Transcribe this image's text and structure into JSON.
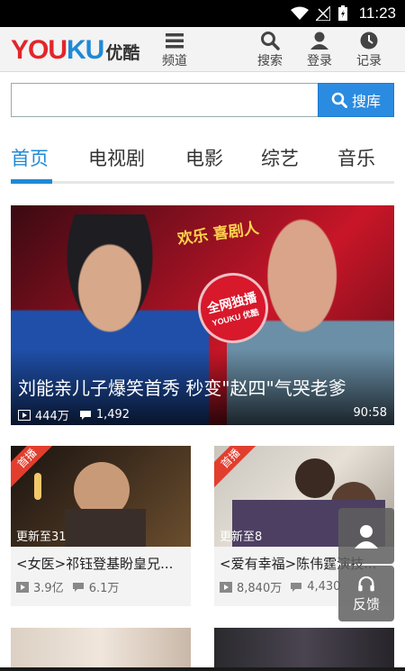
{
  "status_bar": {
    "time": "11:23"
  },
  "header": {
    "logo_en_a": "YOU",
    "logo_en_b": "KU",
    "logo_cn": "优酷",
    "channels_label": "频道",
    "search_label": "搜索",
    "login_label": "登录",
    "history_label": "记录"
  },
  "search": {
    "placeholder": "",
    "value": "",
    "button_label": "搜库"
  },
  "tabs": [
    {
      "label": "首页",
      "active": true
    },
    {
      "label": "电视剧"
    },
    {
      "label": "电影"
    },
    {
      "label": "综艺"
    },
    {
      "label": "音乐"
    }
  ],
  "hero": {
    "show_logo": "欢乐 喜剧人",
    "stamp_line1": "全网独播",
    "stamp_line2": "YOUKU 优酷",
    "title": "刘能亲儿子爆笑首秀 秒变\"赵四\"气哭老爹",
    "plays": "444万",
    "comments": "1,492",
    "duration": "90:58"
  },
  "cards": [
    {
      "corner": "首播",
      "update": "更新至31",
      "title": "<女医>祁钰登基盼皇兄...",
      "plays": "3.9亿",
      "comments": "6.1万"
    },
    {
      "corner": "首播",
      "update": "更新至8",
      "title": "<爱有幸福>陈伟霆演技...",
      "plays": "8,840万",
      "comments": "4,430"
    }
  ],
  "floating": {
    "feedback_label": "反馈"
  },
  "colors": {
    "accent": "#1f8ad6",
    "brand_red": "#e2262a",
    "search_button": "#2b8be0"
  }
}
